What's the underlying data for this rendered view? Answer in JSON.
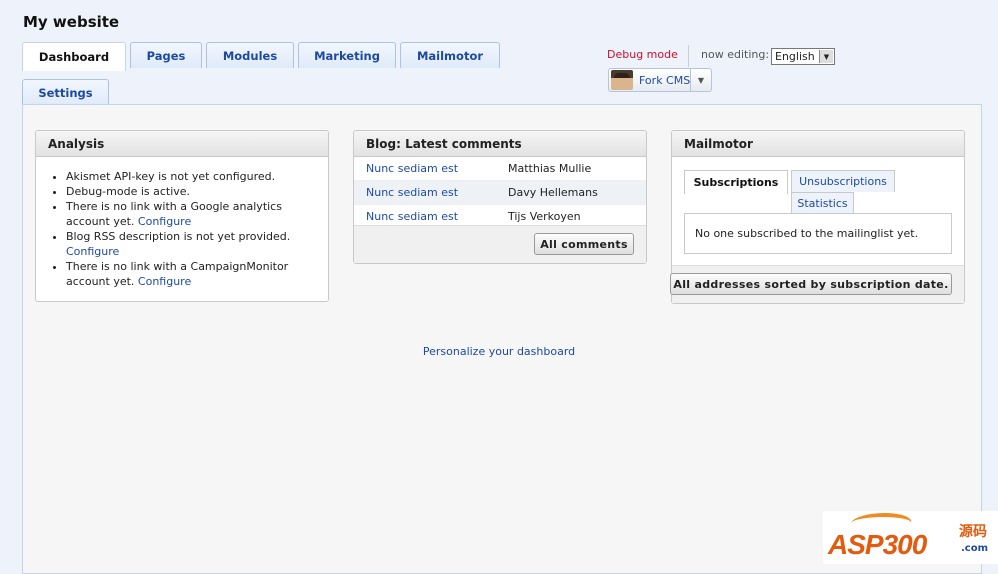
{
  "site": {
    "title": "My website"
  },
  "tabs": [
    {
      "label": "Dashboard"
    },
    {
      "label": "Pages"
    },
    {
      "label": "Modules"
    },
    {
      "label": "Marketing"
    },
    {
      "label": "Mailmotor"
    },
    {
      "label": "Settings"
    }
  ],
  "topbar": {
    "debug_mode": "Debug mode",
    "now_editing": "now editing:",
    "language": "English",
    "user_name": "Fork CMS"
  },
  "analysis": {
    "title": "Analysis",
    "items": [
      {
        "text": "Akismet API-key is not yet configured.",
        "link": ""
      },
      {
        "text": "Debug-mode is active.",
        "link": ""
      },
      {
        "text": "There is no link with a Google analytics account yet.",
        "link": "Configure"
      },
      {
        "text": "Blog RSS description is not yet provided.",
        "link": "Configure"
      },
      {
        "text": "There is no link with a CampaignMonitor account yet.",
        "link": "Configure"
      }
    ]
  },
  "blog": {
    "title": "Blog: Latest comments",
    "rows": [
      {
        "post": "Nunc sediam est",
        "author": "Matthias Mullie"
      },
      {
        "post": "Nunc sediam est",
        "author": "Davy Hellemans"
      },
      {
        "post": "Nunc sediam est",
        "author": "Tijs Verkoyen"
      }
    ],
    "button": "All comments"
  },
  "mailmotor": {
    "title": "Mailmotor",
    "tabs": [
      "Subscriptions",
      "Unsubscriptions",
      "Statistics"
    ],
    "empty_message": "No one subscribed to the mailinglist yet.",
    "button": "All addresses sorted by subscription date."
  },
  "footer": {
    "personalize": "Personalize your dashboard"
  },
  "watermark": {
    "brand": "ASP300",
    "side": "源码",
    "domain": ".com"
  },
  "colors": {
    "link": "#1d4a9c",
    "debug": "#c8102e",
    "background": "#eef3fb"
  }
}
